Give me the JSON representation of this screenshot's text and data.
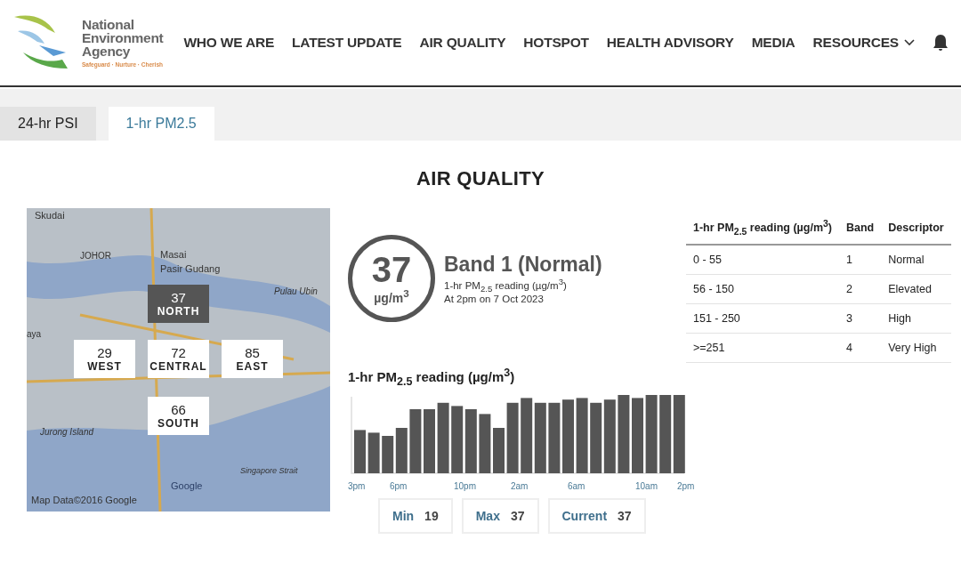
{
  "logo": {
    "name_lines": [
      "National",
      "Environment",
      "Agency"
    ],
    "tagline": "Safeguard · Nurture · Cherish"
  },
  "nav": [
    "WHO WE ARE",
    "LATEST UPDATE",
    "AIR QUALITY",
    "HOTSPOT",
    "HEALTH ADVISORY",
    "MEDIA",
    "RESOURCES"
  ],
  "tabs": [
    {
      "label": "24-hr PSI",
      "selected": false
    },
    {
      "label": "1-hr PM2.5",
      "selected": true
    }
  ],
  "heading": "AIR QUALITY",
  "map": {
    "places": [
      "Skudai",
      "JOHOR",
      "Masai",
      "Pasir Gudang",
      "Pulau Ubin",
      "aya",
      "Jurong Island",
      "Singapore Strait"
    ],
    "attribution": "Map Data©2016 Google",
    "google": "Google",
    "regions": [
      {
        "value": "37",
        "name": "NORTH",
        "selected": true
      },
      {
        "value": "29",
        "name": "WEST",
        "selected": false
      },
      {
        "value": "72",
        "name": "CENTRAL",
        "selected": false
      },
      {
        "value": "85",
        "name": "EAST",
        "selected": false
      },
      {
        "value": "66",
        "name": "SOUTH",
        "selected": false
      }
    ]
  },
  "reading": {
    "value": "37",
    "unit": "µg/m$^{3}$",
    "band": "Band 1 (Normal)",
    "caption": "1-hr PM$_{2.5}$ reading (µg/m$^{3}$)",
    "time": "At 2pm on 7 Oct 2023"
  },
  "band_table": {
    "columns": [
      "1-hr PM$_{2.5}$ reading (µg/m$^{3}$)",
      "Band",
      "Descriptor"
    ],
    "rows": [
      [
        "0 - 55",
        "1",
        "Normal"
      ],
      [
        "56 - 150",
        "2",
        "Elevated"
      ],
      [
        "151 - 250",
        "3",
        "High"
      ],
      [
        ">=251",
        "4",
        "Very High"
      ]
    ]
  },
  "chart": {
    "title": "1-hr PM$_{2.5}$ reading (µg/m$^{3}$)",
    "x_labels": [
      "3pm",
      "6pm",
      "10pm",
      "2am",
      "6am",
      "10am",
      "2pm"
    ]
  },
  "stats": [
    {
      "label": "Min",
      "value": "19"
    },
    {
      "label": "Max",
      "value": "37"
    },
    {
      "label": "Current",
      "value": "37"
    }
  ]
}
